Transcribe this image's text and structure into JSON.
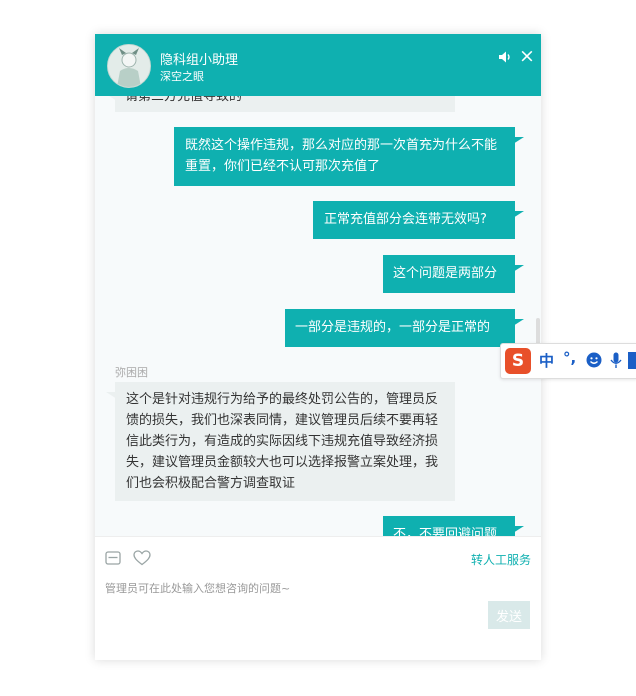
{
  "header": {
    "title": "隐科组小助理",
    "subtitle": "深空之眼",
    "close_glyph": "×"
  },
  "icons": {
    "sound": "speaker-icon",
    "close": "close-icon",
    "email": "email-icon",
    "heart": "heart-icon",
    "ime_logo": "sogou-s-icon",
    "emoji": "smile-icon",
    "mic": "microphone-icon"
  },
  "messages": [
    {
      "side": "in",
      "text": "请第三方充值导致的"
    },
    {
      "side": "out",
      "text": "既然这个操作违规，那么对应的那一次首充为什么不能重置，你们已经不认可那次充值了"
    },
    {
      "side": "out",
      "text": "正常充值部分会连带无效吗?"
    },
    {
      "side": "out",
      "text": "这个问题是两部分"
    },
    {
      "side": "out",
      "text": "一部分是违规的，一部分是正常的"
    },
    {
      "side": "in",
      "sender": "弥困困",
      "text": "这个是针对违规行为给予的最终处罚公告的，管理员反馈的损失，我们也深表同情，建议管理员后续不要再轻信此类行为，有造成的实际因线下违规充值导致经济损失，建议管理员金额较大也可以选择报警立案处理，我们也会积极配合警方调查取证"
    },
    {
      "side": "out",
      "text": "不，不要回避问题"
    }
  ],
  "toolbar": {
    "transfer_label": "转人工服务"
  },
  "composer": {
    "placeholder": "管理员可在此处输入您想咨询的问题~",
    "send_label": "发送"
  },
  "ime": {
    "logo": "S",
    "mode": "中",
    "punct": "°,"
  },
  "colors": {
    "accent": "#0fb0b0",
    "incoming_bubble": "#ebf0f0",
    "send_disabled": "#d9e9e9",
    "ime_logo": "#e8502a",
    "ime_blue": "#1b5fc6"
  }
}
